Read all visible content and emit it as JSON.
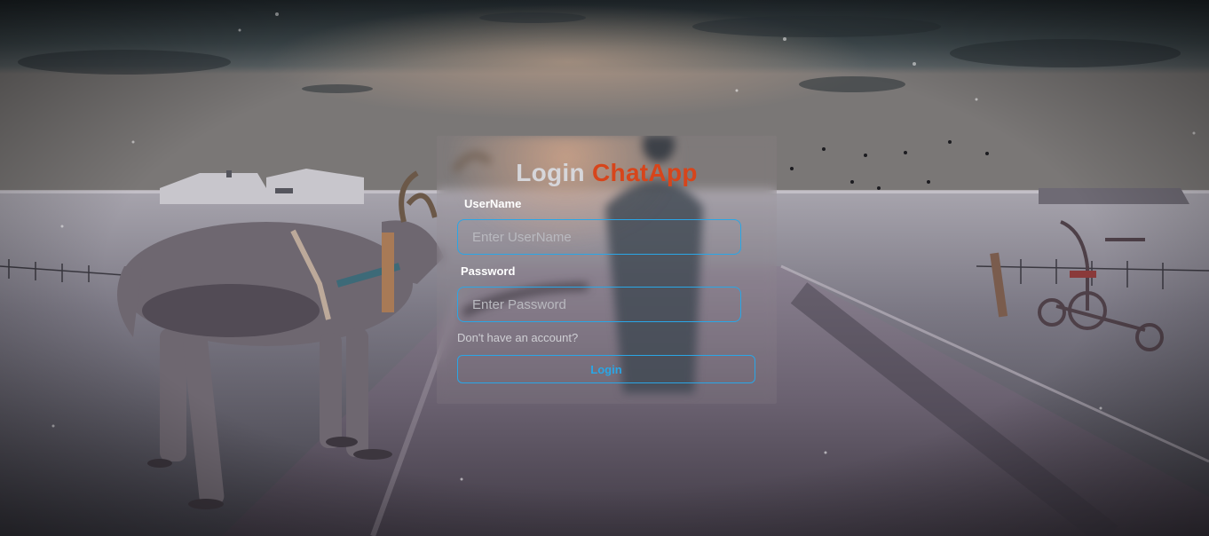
{
  "login": {
    "title_part1": "Login",
    "title_part2": "ChatApp",
    "username_label": "UserName",
    "username_placeholder": "Enter UserName",
    "password_label": "Password",
    "password_placeholder": "Enter Password",
    "signup_link": "Don't have an account?",
    "login_button": "Login"
  },
  "colors": {
    "accent": "#2aa6e6",
    "brand": "#d7451b",
    "title_gray": "#d6d6da"
  },
  "background": {
    "icon": "winter-road-reindeer-photo"
  }
}
